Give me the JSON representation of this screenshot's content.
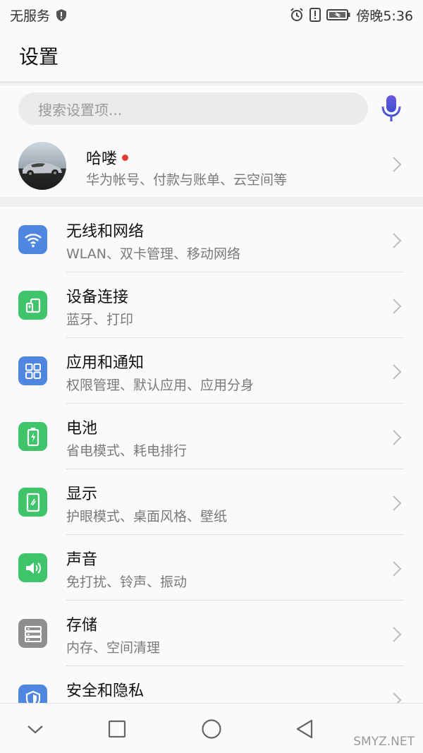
{
  "status_bar": {
    "carrier": "无服务",
    "time": "傍晚5:36",
    "icons": [
      "shield-icon",
      "alarm-icon",
      "alert-icon",
      "battery-icon"
    ]
  },
  "header": {
    "title": "设置"
  },
  "search": {
    "placeholder": "搜索设置项...",
    "mic_icon": "microphone-icon",
    "mic_color": "#5b4fd6"
  },
  "account": {
    "name": "哈喽",
    "subtitle": "华为帐号、付款与账单、云空间等",
    "badge_color": "#e53935"
  },
  "items": [
    {
      "title": "无线和网络",
      "subtitle": "WLAN、双卡管理、移动网络",
      "icon": "wifi-icon",
      "color": "#4f86e0"
    },
    {
      "title": "设备连接",
      "subtitle": "蓝牙、打印",
      "icon": "device-connect-icon",
      "color": "#3fc46b"
    },
    {
      "title": "应用和通知",
      "subtitle": "权限管理、默认应用、应用分身",
      "icon": "apps-grid-icon",
      "color": "#4f86e0"
    },
    {
      "title": "电池",
      "subtitle": "省电模式、耗电排行",
      "icon": "battery-icon",
      "color": "#3fc46b"
    },
    {
      "title": "显示",
      "subtitle": "护眼模式、桌面风格、壁纸",
      "icon": "display-icon",
      "color": "#3fc46b"
    },
    {
      "title": "声音",
      "subtitle": "免打扰、铃声、振动",
      "icon": "speaker-icon",
      "color": "#3fc46b"
    },
    {
      "title": "存储",
      "subtitle": "内存、空间清理",
      "icon": "storage-icon",
      "color": "#8e8e8e"
    },
    {
      "title": "安全和隐私",
      "subtitle": "",
      "icon": "security-icon",
      "color": "#4f86e0"
    }
  ],
  "navbar": {
    "icons": [
      "chevron-down-icon",
      "square-icon",
      "circle-icon",
      "back-triangle-icon"
    ]
  },
  "watermark": "SMYZ.NET"
}
